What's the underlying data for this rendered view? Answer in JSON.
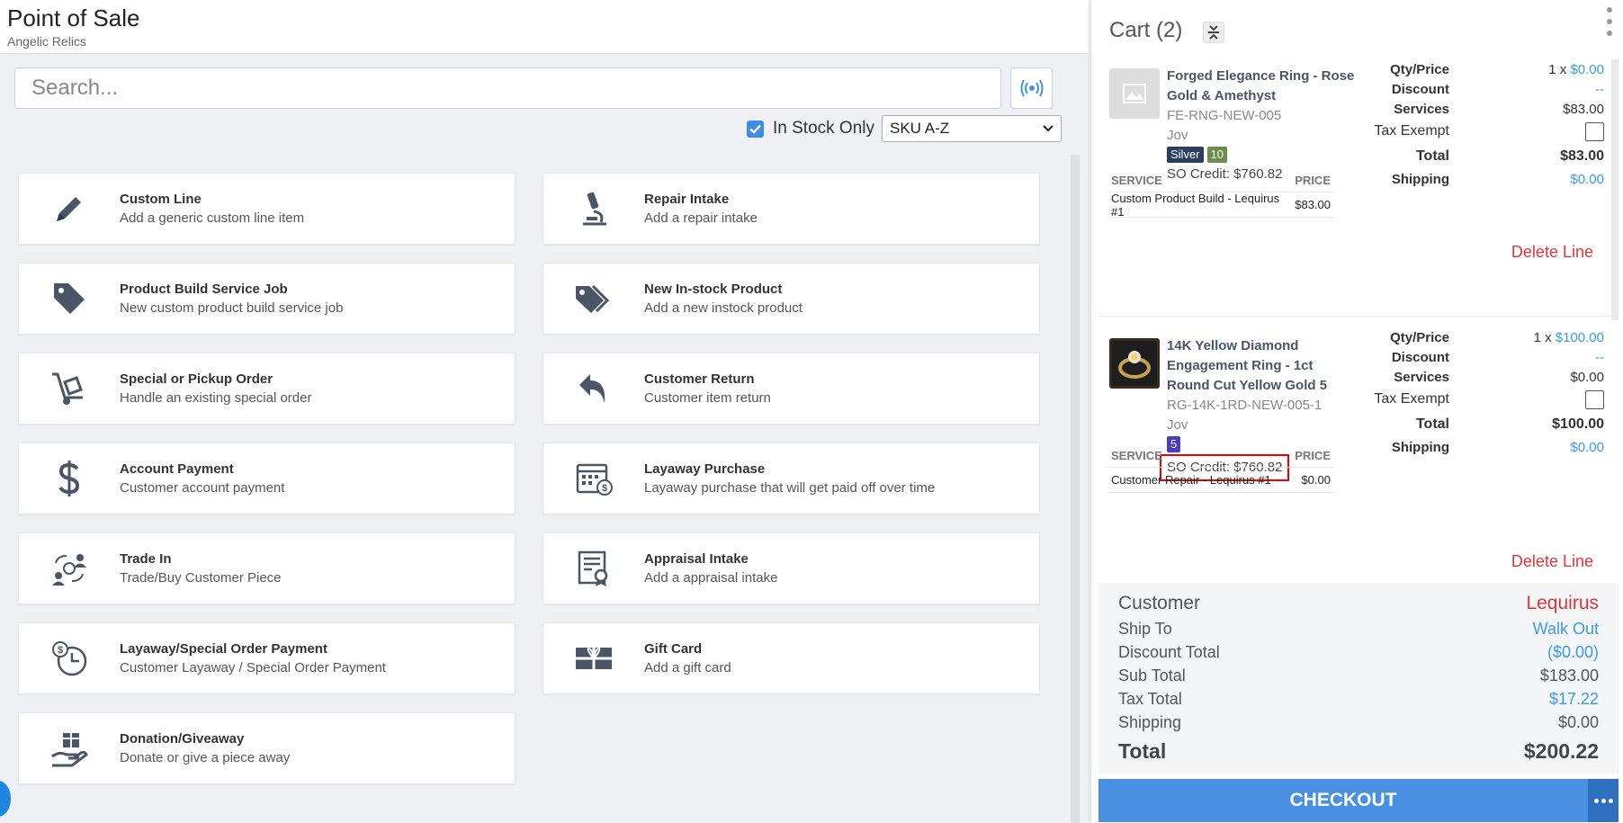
{
  "header": {
    "title": "Point of Sale",
    "subtitle": "Angelic Relics"
  },
  "search": {
    "placeholder": "Search...",
    "value": ""
  },
  "filters": {
    "in_stock_label": "In Stock Only",
    "in_stock_checked": true,
    "sort_value": "SKU A-Z"
  },
  "tiles": [
    {
      "title": "Custom Line",
      "subtitle": "Add a generic custom line item",
      "icon": "pencil-icon"
    },
    {
      "title": "Repair Intake",
      "subtitle": "Add a repair intake",
      "icon": "microscope-icon"
    },
    {
      "title": "Product Build Service Job",
      "subtitle": "New custom product build service job",
      "icon": "tag-icon"
    },
    {
      "title": "New In-stock Product",
      "subtitle": "Add a new instock product",
      "icon": "tags-icon"
    },
    {
      "title": "Special or Pickup Order",
      "subtitle": "Handle an existing special order",
      "icon": "dolly-icon"
    },
    {
      "title": "Customer Return",
      "subtitle": "Customer item return",
      "icon": "reply-icon"
    },
    {
      "title": "Account Payment",
      "subtitle": "Customer account payment",
      "icon": "dollar-icon"
    },
    {
      "title": "Layaway Purchase",
      "subtitle": "Layaway purchase that will get paid off over time",
      "icon": "calendar-dollar-icon"
    },
    {
      "title": "Trade In",
      "subtitle": "Trade/Buy Customer Piece",
      "icon": "users-exchange-icon"
    },
    {
      "title": "Appraisal Intake",
      "subtitle": "Add a appraisal intake",
      "icon": "certificate-icon"
    },
    {
      "title": "Layaway/Special Order Payment",
      "subtitle": "Customer Layaway / Special Order Payment",
      "icon": "clock-dollar-icon"
    },
    {
      "title": "Gift Card",
      "subtitle": "Add a gift card",
      "icon": "gift-card-icon"
    },
    {
      "title": "Donation/Giveaway",
      "subtitle": "Donate or give a piece away",
      "icon": "hand-gift-icon"
    }
  ],
  "cart": {
    "title": "Cart (2)",
    "labels": {
      "qty_price": "Qty/Price",
      "discount": "Discount",
      "services": "Services",
      "tax_exempt": "Tax Exempt",
      "total": "Total",
      "shipping": "Shipping",
      "service_col": "SERVICE",
      "price_col": "PRICE",
      "delete": "Delete Line"
    },
    "lines": [
      {
        "name": "Forged Elegance Ring - Rose Gold & Amethyst",
        "sku": "FE-RNG-NEW-005",
        "person": "Jov",
        "badges": [
          {
            "text": "Silver",
            "color": "#2c3e60"
          },
          {
            "text": "10",
            "color": "#6b8e4e"
          }
        ],
        "so_credit": "SO Credit: $760.82",
        "qty": "1 x",
        "price": "$0.00",
        "discount": "--",
        "services": "$83.00",
        "total": "$83.00",
        "shipping": "$0.00",
        "service_rows": [
          {
            "service": "Custom Product Build - Lequirus #1",
            "price": "$83.00"
          }
        ]
      },
      {
        "name": "14K Yellow Diamond Engagement Ring - 1ct Round Cut Yellow Gold 5",
        "sku": "RG-14K-1RD-NEW-005-1",
        "person": "Jov",
        "badges": [
          {
            "text": "5",
            "color": "#4b3cc4"
          }
        ],
        "so_credit": "SO Credit: $760.82",
        "qty": "1 x",
        "price": "$100.00",
        "discount": "--",
        "services": "$0.00",
        "total": "$100.00",
        "shipping": "$0.00",
        "service_rows": [
          {
            "service": "Customer Repair - Lequirus #1",
            "price": "$0.00"
          }
        ]
      }
    ],
    "summary": {
      "customer_label": "Customer",
      "customer_value": "Lequirus",
      "ship_to_label": "Ship To",
      "ship_to_value": "Walk Out",
      "discount_label": "Discount Total",
      "discount_value": "($0.00)",
      "subtotal_label": "Sub Total",
      "subtotal_value": "$183.00",
      "tax_label": "Tax Total",
      "tax_value": "$17.22",
      "shipping_label": "Shipping",
      "shipping_value": "$0.00",
      "total_label": "Total",
      "total_value": "$200.22"
    },
    "checkout_label": "CHECKOUT"
  },
  "colors": {
    "accent": "#4a90e2",
    "link": "#3b9be8",
    "danger": "#e0363a"
  }
}
